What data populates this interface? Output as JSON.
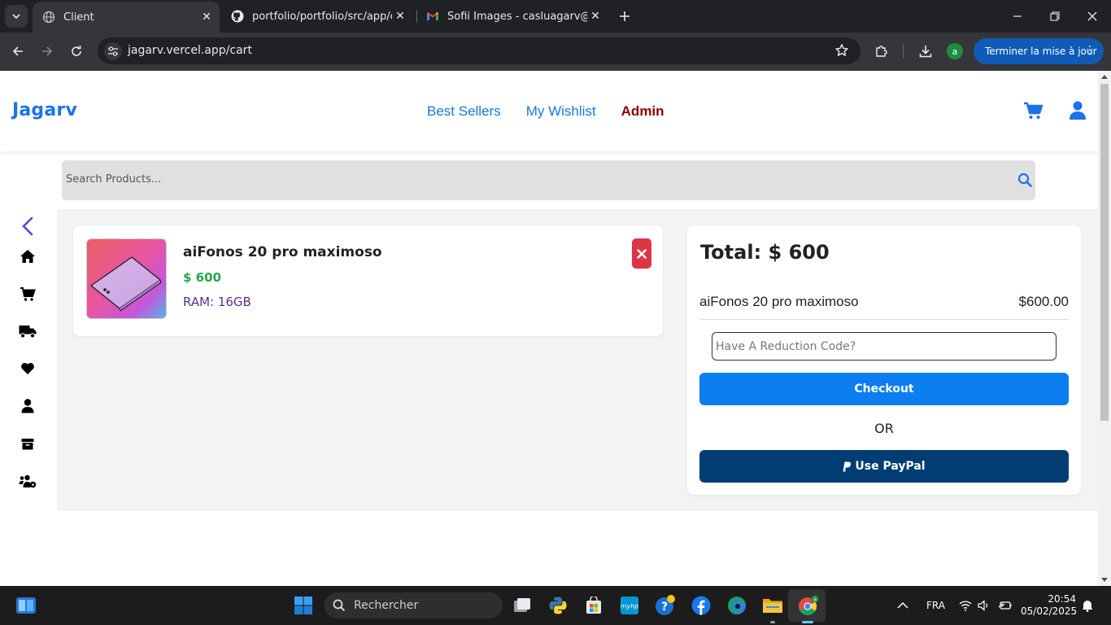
{
  "browser": {
    "tabs": [
      {
        "title": "Client",
        "active": true
      },
      {
        "title": "portfolio/portfolio/src/app/com",
        "active": false
      },
      {
        "title": "Sofii Images - casluagarv@gma",
        "active": false
      }
    ],
    "url": "jagarv.vercel.app/cart",
    "profile_initial": "a",
    "update_label": "Terminer la mise à jour"
  },
  "header": {
    "brand": "Jagarv",
    "nav": {
      "best_sellers": "Best Sellers",
      "wishlist": "My Wishlist",
      "admin": "Admin"
    }
  },
  "search": {
    "placeholder": "Search Products..."
  },
  "sidebar": {
    "icons": [
      "chevron-left-icon",
      "home-icon",
      "cart-icon",
      "truck-icon",
      "heart-icon",
      "user-icon",
      "box-icon",
      "users-cog-icon"
    ]
  },
  "cart": {
    "items": [
      {
        "name": "aiFonos 20 pro maximoso",
        "price": "$ 600",
        "ram": "RAM: 16GB"
      }
    ]
  },
  "summary": {
    "total": "Total: $ 600",
    "lines": [
      {
        "name": "aiFonos 20 pro maximoso",
        "price": "$600.00"
      }
    ],
    "code_placeholder": "Have A Reduction Code?",
    "checkout": "Checkout",
    "or": "OR",
    "paypal": "Use PayPal"
  },
  "taskbar": {
    "search_label": "Rechercher",
    "language": "FRA",
    "time": "20:54",
    "date": "05/02/2025"
  },
  "colors": {
    "brand_blue": "#1a73e8",
    "admin_red": "#8b0000",
    "price_green": "#28a745",
    "ram_purple": "#5b2d90",
    "remove_red": "#dc3545",
    "checkout_blue": "#0d7ef0",
    "paypal_navy": "#003d73"
  }
}
